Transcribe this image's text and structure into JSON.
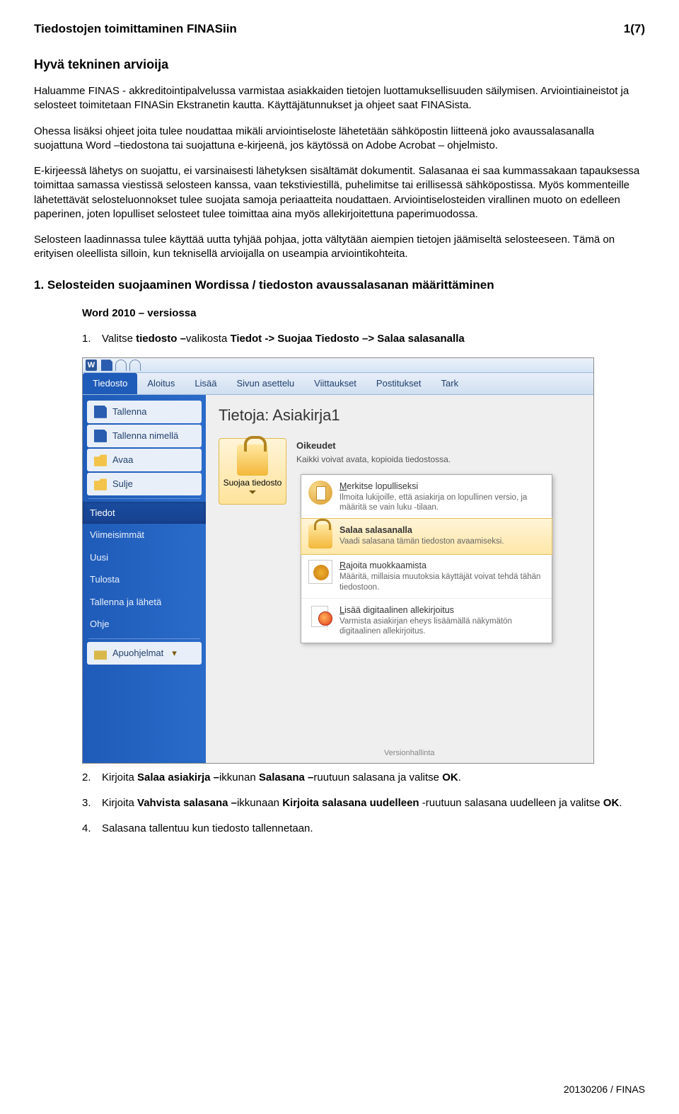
{
  "header": {
    "title": "Tiedostojen toimittaminen FINASiin",
    "page": "1(7)"
  },
  "h1": "Hyvä tekninen arvioija",
  "p1": "Haluamme FINAS - akkreditointipalvelussa varmistaa asiakkaiden tietojen luottamuksellisuuden säilymisen. Arviointiaineistot ja selosteet toimitetaan FINASin Ekstranetin kautta. Käyttäjätunnukset ja ohjeet saat FINASista.",
  "p2": "Ohessa lisäksi ohjeet joita tulee noudattaa mikäli arviointiseloste lähetetään sähköpostin liitteenä joko avaussalasanalla suojattuna Word –tiedostona tai suojattuna e-kirjeenä, jos käytössä on Adobe Acrobat – ohjelmisto.",
  "p3": "E-kirjeessä lähetys on suojattu, ei varsinaisesti lähetyksen sisältämät dokumentit. Salasanaa ei saa kummassakaan tapauksessa toimittaa samassa viestissä selosteen kanssa, vaan tekstiviestillä, puhelimitse tai erillisessä sähköpostissa. Myös kommenteille lähetettävät selosteluonnokset tulee suojata samoja periaatteita noudattaen. Arviointiselosteiden virallinen muoto on edelleen paperinen, joten lopulliset selosteet tulee toimittaa aina myös allekirjoitettuna paperimuodossa.",
  "p4": "Selosteen laadinnassa tulee käyttää uutta tyhjää pohjaa, jotta vältytään aiempien tietojen jäämiseltä selosteeseen. Tämä on erityisen oleellista silloin, kun teknisellä arvioijalla on useampia arviointikohteita.",
  "section": "1. Selosteiden suojaaminen Wordissa / tiedoston avaussalasanan määrittäminen",
  "word_version": "Word 2010 – versiossa",
  "steps": {
    "s1_pre": "Valitse ",
    "s1_b1": "tiedosto –",
    "s1_mid": "valikosta ",
    "s1_b2": "Tiedot -> Suojaa Tiedosto –> Salaa salasanalla",
    "s2_a": "Kirjoita ",
    "s2_b": "Salaa asiakirja –",
    "s2_c": "ikkunan ",
    "s2_d": "Salasana –",
    "s2_e": "ruutuun salasana ja valitse ",
    "s2_f": "OK",
    "s2_g": ".",
    "s3_a": "Kirjoita ",
    "s3_b": "Vahvista salasana –",
    "s3_c": "ikkunaan ",
    "s3_d": "Kirjoita salasana uudelleen ",
    "s3_e": "-ruutuun salasana uudelleen ja valitse ",
    "s3_f": "OK",
    "s3_g": ".",
    "s4": "Salasana tallentuu kun tiedosto tallennetaan."
  },
  "word_ui": {
    "tabs": [
      "Tiedosto",
      "Aloitus",
      "Lisää",
      "Sivun asettelu",
      "Viittaukset",
      "Postitukset",
      "Tark"
    ],
    "side": {
      "save": "Tallenna",
      "saveas": "Tallenna nimellä",
      "open": "Avaa",
      "close": "Sulje",
      "info": "Tiedot",
      "recent": "Viimeisimmät",
      "new": "Uusi",
      "print": "Tulosta",
      "saveSend": "Tallenna ja lähetä",
      "help": "Ohje",
      "addins": "Apuohjelmat"
    },
    "main": {
      "title": "Tietoja: Asiakirja1",
      "perm_head": "Oikeudet",
      "perm_sub": "Kaikki voivat avata, kopioida tiedostossa.",
      "protect_label": "Suojaa tiedosto",
      "menu": {
        "final_t": "Merkitse lopulliseksi",
        "final_d": "Ilmoita lukijoille, että asiakirja on lopullinen versio, ja määritä se vain luku -tilaan.",
        "enc_t": "Salaa salasanalla",
        "enc_d": "Vaadi salasana tämän tiedoston avaamiseksi.",
        "res_t": "Rajoita muokkaamista",
        "res_d": "Määritä, millaisia muutoksia käyttäjät voivat tehdä tähän tiedostoon.",
        "sig_t": "Lisää digitaalinen allekirjoitus",
        "sig_d": "Varmista asiakirjan eheys lisäämällä näkymätön digitaalinen allekirjoitus.",
        "ver_cut": "Versionhallinta"
      }
    }
  },
  "footer": "20130206 / FINAS"
}
